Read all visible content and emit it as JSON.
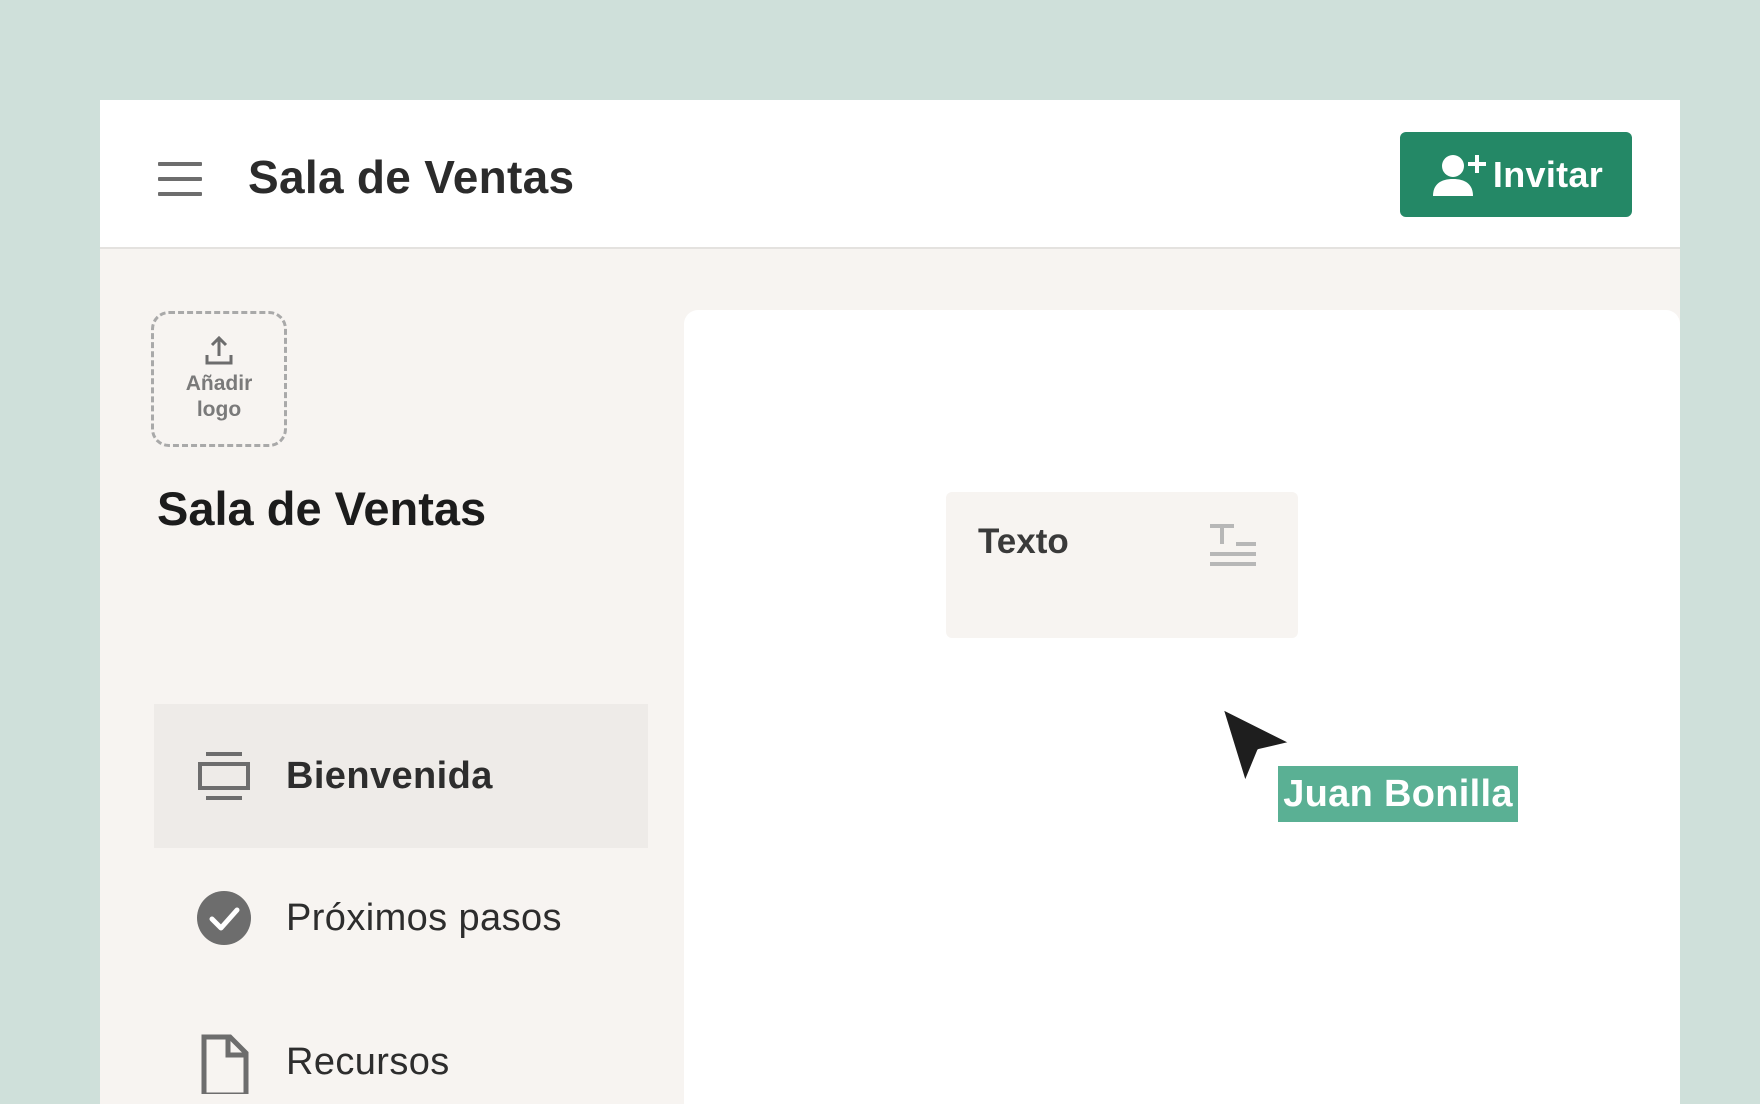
{
  "header": {
    "title": "Sala de Ventas",
    "menu_icon": "hamburger-menu-icon",
    "invite_button": {
      "label": "Invitar",
      "icon": "add-user-icon",
      "color": "#248866"
    }
  },
  "sidebar": {
    "logo_upload": {
      "label": "Añadir logo",
      "icon": "upload-icon"
    },
    "title": "Sala de Ventas",
    "items": [
      {
        "label": "Bienvenida",
        "icon": "slides-icon",
        "active": true
      },
      {
        "label": "Próximos pasos",
        "icon": "check-circle-icon",
        "active": false
      },
      {
        "label": "Recursos",
        "icon": "document-icon",
        "active": false
      }
    ]
  },
  "canvas": {
    "text_block": {
      "label": "Texto",
      "icon": "text-format-icon"
    },
    "collaborator": {
      "name": "Juan Bonilla",
      "color": "#5ab094"
    }
  },
  "colors": {
    "background": "#cfe0da",
    "accent": "#248866",
    "sidebar_bg": "#f7f4f1",
    "active_item_bg": "#eeebe8"
  }
}
